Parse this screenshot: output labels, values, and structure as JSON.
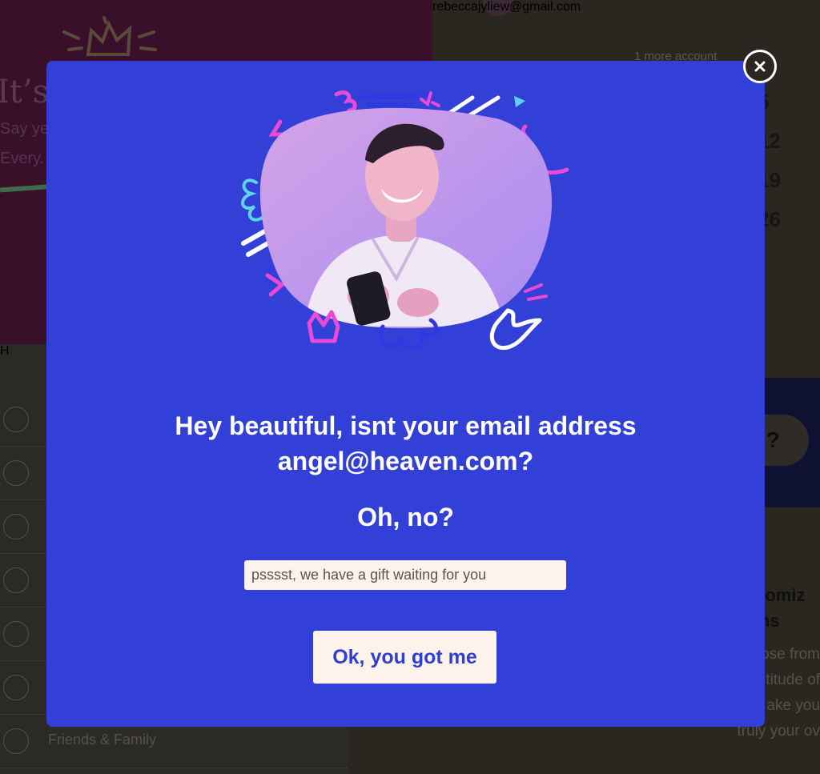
{
  "background": {
    "headline": "It’s",
    "subtext_lines": [
      "Say ye",
      "Every."
    ],
    "list_header": "H",
    "list_items": [
      "",
      "",
      "",
      "",
      "",
      "",
      "Friends & Family"
    ],
    "account_email": "rebeccajyliew@gmail.com",
    "more_accounts": "1 more account",
    "numbers": [
      "5",
      "12",
      "19",
      "26"
    ],
    "pill_text": "?",
    "customize_title_lines": [
      "tomiz",
      "ns"
    ],
    "paragraph_lines": [
      "ose from",
      "titude of",
      "ake you",
      "truly your ov"
    ]
  },
  "modal": {
    "title_lines": [
      "Hey beautiful, isnt your email address",
      "angel@heaven.com?"
    ],
    "question": "Oh, no?",
    "input": {
      "value": "",
      "placeholder": "psssst, we have a gift waiting for you"
    },
    "confirm_label": "Ok, you got me",
    "close_icon": "close-icon"
  },
  "colors": {
    "modal_bg": "#3240d8",
    "button_bg": "#fdf3ea",
    "button_text": "#2f3ed4",
    "overlay_dark": "#2a2620"
  }
}
